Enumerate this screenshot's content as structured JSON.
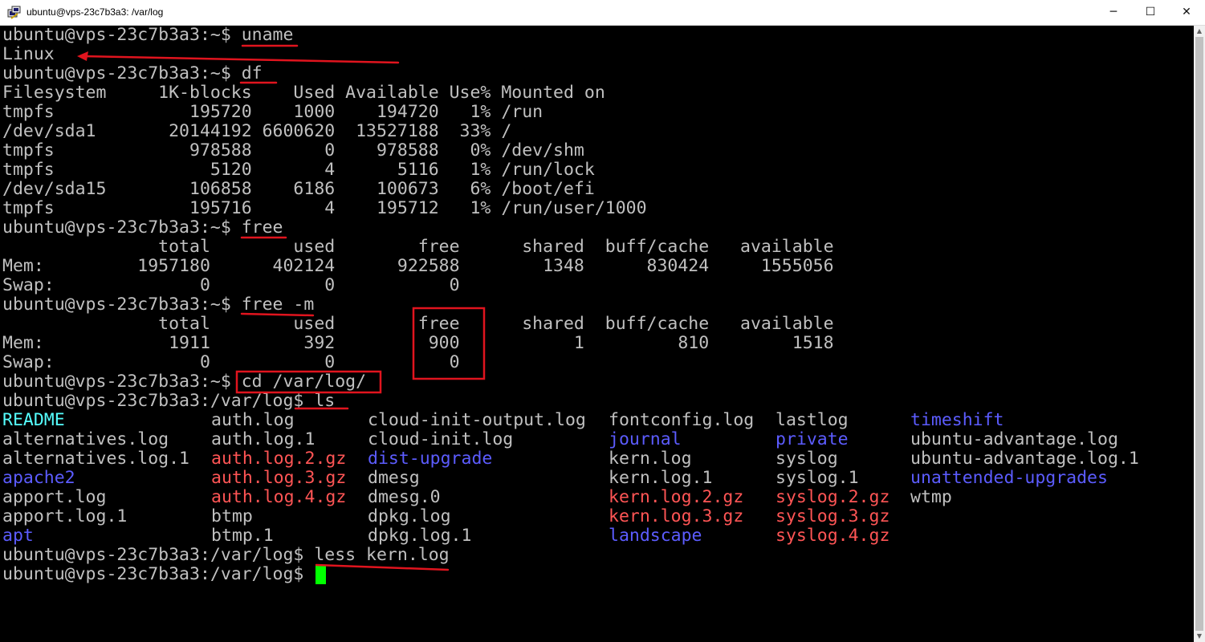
{
  "window": {
    "title": "ubuntu@vps-23c7b3a3: /var/log",
    "min_glyph": "─",
    "max_glyph": "☐",
    "close_glyph": "✕"
  },
  "terminal": {
    "lines": [
      "ubuntu@vps-23c7b3a3:~$ uname",
      "Linux",
      "ubuntu@vps-23c7b3a3:~$ df",
      "Filesystem     1K-blocks    Used Available Use% Mounted on",
      "tmpfs             195720    1000    194720   1% /run",
      "/dev/sda1       20144192 6600620  13527188  33% /",
      "tmpfs             978588       0    978588   0% /dev/shm",
      "tmpfs               5120       4      5116   1% /run/lock",
      "/dev/sda15        106858    6186    100673   6% /boot/efi",
      "tmpfs             195716       4    195712   1% /run/user/1000",
      "ubuntu@vps-23c7b3a3:~$ free",
      "               total        used        free      shared  buff/cache   available",
      "Mem:         1957180      402124      922588        1348      830424     1555056",
      "Swap:              0           0           0",
      "ubuntu@vps-23c7b3a3:~$ free -m",
      "               total        used        free      shared  buff/cache   available",
      "Mem:            1911         392         900           1         810        1518",
      "Swap:              0           0           0",
      "ubuntu@vps-23c7b3a3:~$ cd /var/log/",
      "ubuntu@vps-23c7b3a3:/var/log$ ls"
    ],
    "ls_columns": [
      [
        {
          "name": "README",
          "color": "cyan"
        },
        {
          "name": "alternatives.log",
          "color": "plain"
        },
        {
          "name": "alternatives.log.1",
          "color": "plain"
        },
        {
          "name": "apache2",
          "color": "blue"
        },
        {
          "name": "apport.log",
          "color": "plain"
        },
        {
          "name": "apport.log.1",
          "color": "plain"
        },
        {
          "name": "apt",
          "color": "blue"
        }
      ],
      [
        {
          "name": "auth.log",
          "color": "plain"
        },
        {
          "name": "auth.log.1",
          "color": "plain"
        },
        {
          "name": "auth.log.2.gz",
          "color": "red"
        },
        {
          "name": "auth.log.3.gz",
          "color": "red"
        },
        {
          "name": "auth.log.4.gz",
          "color": "red"
        },
        {
          "name": "btmp",
          "color": "plain"
        },
        {
          "name": "btmp.1",
          "color": "plain"
        }
      ],
      [
        {
          "name": "cloud-init-output.log",
          "color": "plain"
        },
        {
          "name": "cloud-init.log",
          "color": "plain"
        },
        {
          "name": "dist-upgrade",
          "color": "blue"
        },
        {
          "name": "dmesg",
          "color": "plain"
        },
        {
          "name": "dmesg.0",
          "color": "plain"
        },
        {
          "name": "dpkg.log",
          "color": "plain"
        },
        {
          "name": "dpkg.log.1",
          "color": "plain"
        }
      ],
      [
        {
          "name": "fontconfig.log",
          "color": "plain"
        },
        {
          "name": "journal",
          "color": "blue"
        },
        {
          "name": "kern.log",
          "color": "plain"
        },
        {
          "name": "kern.log.1",
          "color": "plain"
        },
        {
          "name": "kern.log.2.gz",
          "color": "red"
        },
        {
          "name": "kern.log.3.gz",
          "color": "red"
        },
        {
          "name": "landscape",
          "color": "blue"
        }
      ],
      [
        {
          "name": "lastlog",
          "color": "plain"
        },
        {
          "name": "private",
          "color": "blue"
        },
        {
          "name": "syslog",
          "color": "plain"
        },
        {
          "name": "syslog.1",
          "color": "plain"
        },
        {
          "name": "syslog.2.gz",
          "color": "red"
        },
        {
          "name": "syslog.3.gz",
          "color": "red"
        },
        {
          "name": "syslog.4.gz",
          "color": "red"
        }
      ],
      [
        {
          "name": "timeshift",
          "color": "blue"
        },
        {
          "name": "ubuntu-advantage.log",
          "color": "plain"
        },
        {
          "name": "ubuntu-advantage.log.1",
          "color": "plain"
        },
        {
          "name": "unattended-upgrades",
          "color": "blue"
        },
        {
          "name": "wtmp",
          "color": "plain"
        }
      ]
    ],
    "after_lines": [
      "ubuntu@vps-23c7b3a3:/var/log$ less kern.log",
      "ubuntu@vps-23c7b3a3:/var/log$ "
    ],
    "colors": {
      "text": "#c0c0c0",
      "directory": "#5c5cff",
      "archive": "#ff5555",
      "special": "#55ffff",
      "cursor": "#00ff00",
      "annotation": "#e0141e"
    }
  }
}
